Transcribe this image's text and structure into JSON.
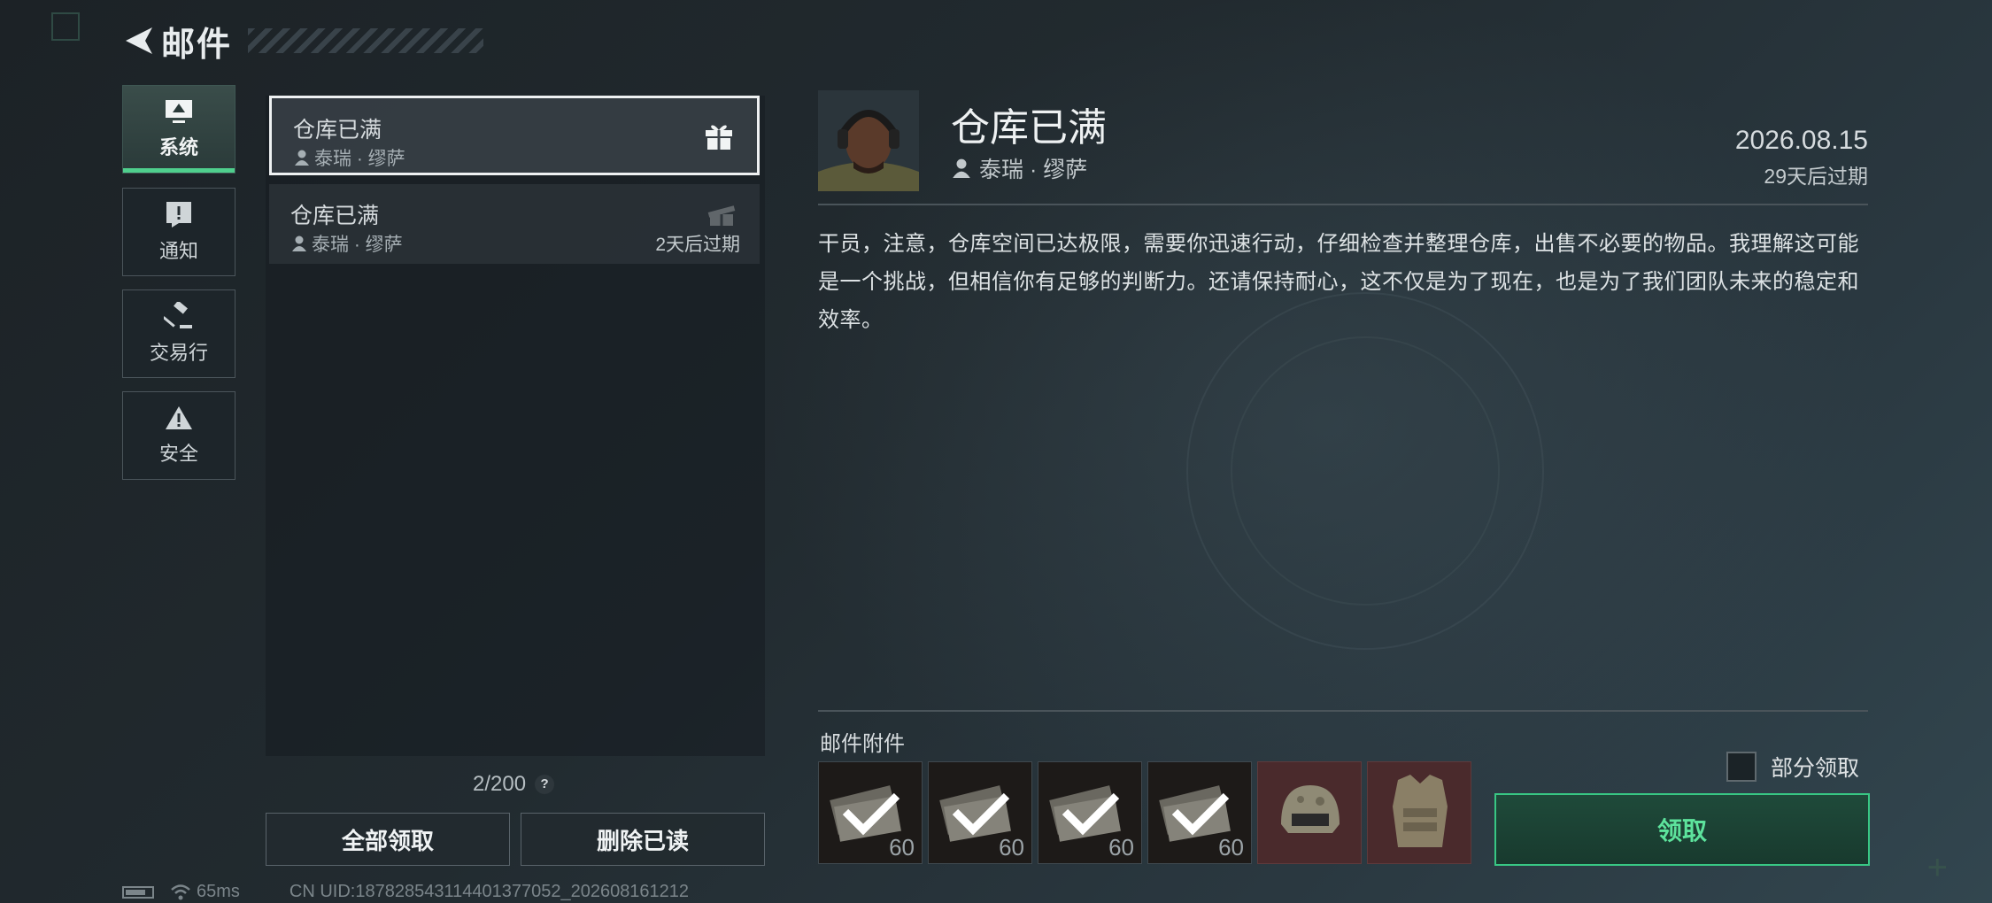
{
  "header": {
    "title": "邮件"
  },
  "categories": [
    {
      "label": "系统",
      "icon": "monitor-icon",
      "active": true
    },
    {
      "label": "通知",
      "icon": "alert-icon",
      "active": false
    },
    {
      "label": "交易行",
      "icon": "gavel-icon",
      "active": false
    },
    {
      "label": "安全",
      "icon": "warning-icon",
      "active": false
    }
  ],
  "mail_list": [
    {
      "title": "仓库已满",
      "sender": "泰瑞 · 缪萨",
      "expire": "",
      "icon": "gift-icon",
      "selected": true
    },
    {
      "title": "仓库已满",
      "sender": "泰瑞 · 缪萨",
      "expire": "2天后过期",
      "icon": "gift-opened-icon",
      "selected": false
    }
  ],
  "counter": "2/200",
  "buttons": {
    "claim_all": "全部领取",
    "delete_read": "删除已读"
  },
  "status_bar": {
    "ping": "65ms",
    "uid": "CN UID:187828543114401377052_202608161212"
  },
  "detail": {
    "title": "仓库已满",
    "sender": "泰瑞 · 缪萨",
    "date": "2026.08.15",
    "expire": "29天后过期",
    "body": "干员，注意，仓库空间已达极限，需要你迅速行动，仔细检查并整理仓库，出售不必要的物品。我理解这可能是一个挑战，但相信你有足够的判断力。还请保持耐心，这不仅是为了现在，也是为了我们团队未来的稳定和效率。"
  },
  "attachments": {
    "label": "邮件附件",
    "items": [
      {
        "type": "cash",
        "count": "60",
        "claimed": true
      },
      {
        "type": "cash",
        "count": "60",
        "claimed": true
      },
      {
        "type": "cash",
        "count": "60",
        "claimed": true
      },
      {
        "type": "cash",
        "count": "60",
        "claimed": true
      },
      {
        "type": "helmet",
        "count": "",
        "claimed": false
      },
      {
        "type": "body-armor",
        "count": "",
        "claimed": false
      }
    ],
    "partial_label": "部分领取",
    "claim_label": "领取"
  },
  "colors": {
    "accent": "#4fcf8d",
    "claim_border": "#38c784",
    "rare_slot": "#4a2a2c"
  }
}
